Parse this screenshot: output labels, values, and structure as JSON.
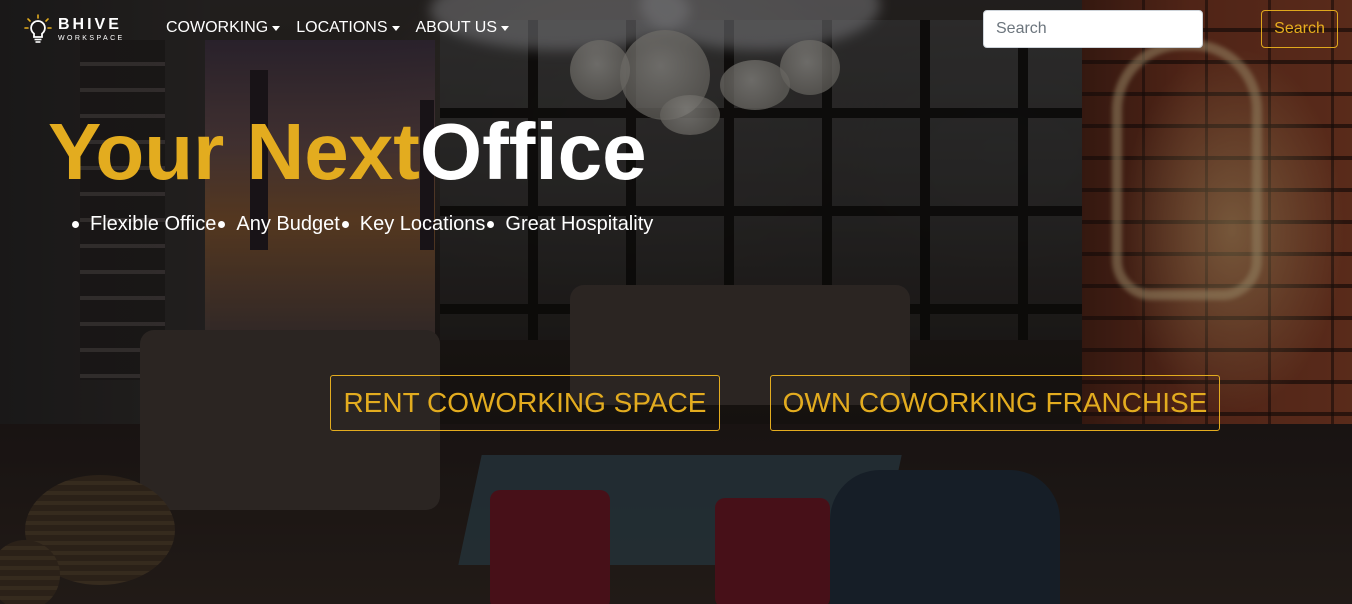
{
  "brand": {
    "name": "BHIVE",
    "tagline": "WORKSPACE",
    "logo_icon": "lightbulb-icon"
  },
  "nav": {
    "items": [
      {
        "label": "COWORKING",
        "icon": "caret-down-icon"
      },
      {
        "label": "LOCATIONS",
        "icon": "caret-down-icon"
      },
      {
        "label": "ABOUT US",
        "icon": "caret-down-icon"
      }
    ]
  },
  "search": {
    "placeholder": "Search",
    "button_label": "Search"
  },
  "hero": {
    "title_accent": "Your Next",
    "title_plain": "Office",
    "features": [
      "Flexible Office",
      "Any Budget",
      "Key Locations",
      "Great Hospitality"
    ],
    "cta_rent": "RENT COWORKING SPACE",
    "cta_own": "OWN COWORKING FRANCHISE"
  },
  "colors": {
    "accent": "#e3ac1f",
    "text": "#ffffff"
  }
}
